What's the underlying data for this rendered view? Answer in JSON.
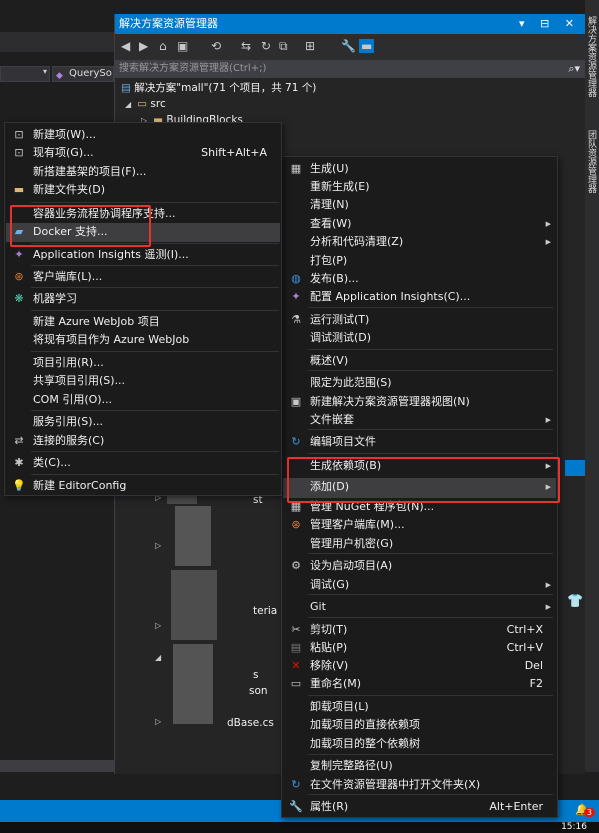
{
  "editor": {
    "query_label": "QuerySo"
  },
  "solution_explorer": {
    "title": "解决方案资源管理器",
    "title_buttons": "▾ ⊟ ✕",
    "search_placeholder": "搜索解决方案资源管理器(Ctrl+;)",
    "tree": {
      "solution": "解决方案\"mall\"(71 个项目，共 71 个)",
      "src": "src",
      "building_blocks": "BuildingBlocks",
      "partial_1": "st",
      "partial_2": "teria",
      "partial_3": "s",
      "partial_4": "son",
      "partial_5": "dBase.cs"
    }
  },
  "right_strip": {
    "tab1": "解决方案资源管理器",
    "tab2": "团队资源管理器"
  },
  "status_bar": {
    "bell_count": "3",
    "clock": "15:16"
  },
  "context_menu": {
    "items": [
      {
        "label": "生成(U)",
        "icon": "build-icon"
      },
      {
        "label": "重新生成(E)"
      },
      {
        "label": "清理(N)"
      },
      {
        "label": "查看(W)",
        "submenu": true
      },
      {
        "label": "分析和代码清理(Z)",
        "submenu": true
      },
      {
        "label": "打包(P)"
      },
      {
        "label": "发布(B)...",
        "icon": "globe-icon"
      },
      {
        "label": "配置 Application Insights(C)...",
        "icon": "insights-icon"
      },
      {
        "label": "运行测试(T)",
        "icon": "flask-icon"
      },
      {
        "label": "调试测试(D)"
      },
      {
        "label": "概述(V)"
      },
      {
        "label": "限定为此范围(S)"
      },
      {
        "label": "新建解决方案资源管理器视图(N)",
        "icon": "new-view-icon"
      },
      {
        "label": "文件嵌套",
        "submenu": true
      },
      {
        "label": "编辑项目文件",
        "icon": "refresh-icon"
      },
      {
        "label": "生成依赖项(B)",
        "submenu": true
      },
      {
        "label": "添加(D)",
        "submenu": true
      },
      {
        "label": "管理 NuGet 程序包(N)...",
        "icon": "nuget-icon"
      },
      {
        "label": "管理客户端库(M)...",
        "icon": "library-icon"
      },
      {
        "label": "管理用户机密(G)"
      },
      {
        "label": "设为启动项目(A)",
        "icon": "gear-icon"
      },
      {
        "label": "调试(G)",
        "submenu": true
      },
      {
        "label": "Git",
        "submenu": true
      },
      {
        "label": "剪切(T)",
        "shortcut": "Ctrl+X",
        "icon": "scissors-icon"
      },
      {
        "label": "粘贴(P)",
        "shortcut": "Ctrl+V",
        "icon": "paste-icon"
      },
      {
        "label": "移除(V)",
        "shortcut": "Del",
        "icon": "close-icon"
      },
      {
        "label": "重命名(M)",
        "shortcut": "F2",
        "icon": "rename-icon"
      },
      {
        "label": "卸载项目(L)"
      },
      {
        "label": "加载项目的直接依赖项"
      },
      {
        "label": "加载项目的整个依赖树"
      },
      {
        "label": "复制完整路径(U)"
      },
      {
        "label": "在文件资源管理器中打开文件夹(X)",
        "icon": "refresh-icon"
      },
      {
        "label": "属性(R)",
        "shortcut": "Alt+Enter",
        "icon": "wrench-icon"
      }
    ]
  },
  "add_submenu": {
    "items": [
      {
        "label": "新建项(W)...",
        "icon": "new-item-icon"
      },
      {
        "label": "现有项(G)...",
        "shortcut": "Shift+Alt+A",
        "icon": "existing-item-icon"
      },
      {
        "label": "新搭建基架的项目(F)..."
      },
      {
        "label": "新建文件夹(D)",
        "icon": "folder-icon"
      },
      {
        "label": "容器业务流程协调程序支持..."
      },
      {
        "label": "Docker 支持...",
        "icon": "docker-icon"
      },
      {
        "label": "Application Insights 遥测(I)...",
        "icon": "insights-icon"
      },
      {
        "label": "客户端库(L)...",
        "icon": "library-icon"
      },
      {
        "label": "机器学习",
        "icon": "ml-icon"
      },
      {
        "label": "新建 Azure WebJob 项目"
      },
      {
        "label": "将现有项目作为 Azure WebJob"
      },
      {
        "label": "项目引用(R)..."
      },
      {
        "label": "共享项目引用(S)..."
      },
      {
        "label": "COM 引用(O)..."
      },
      {
        "label": "服务引用(S)..."
      },
      {
        "label": "连接的服务(C)",
        "icon": "connected-icon"
      },
      {
        "label": "类(C)...",
        "icon": "class-icon"
      },
      {
        "label": "新建 EditorConfig",
        "icon": "bulb-icon"
      }
    ]
  },
  "colors": {
    "accent": "#007acc",
    "highlight_box": "#e8332c",
    "menu_bg": "#1b1b1c"
  }
}
